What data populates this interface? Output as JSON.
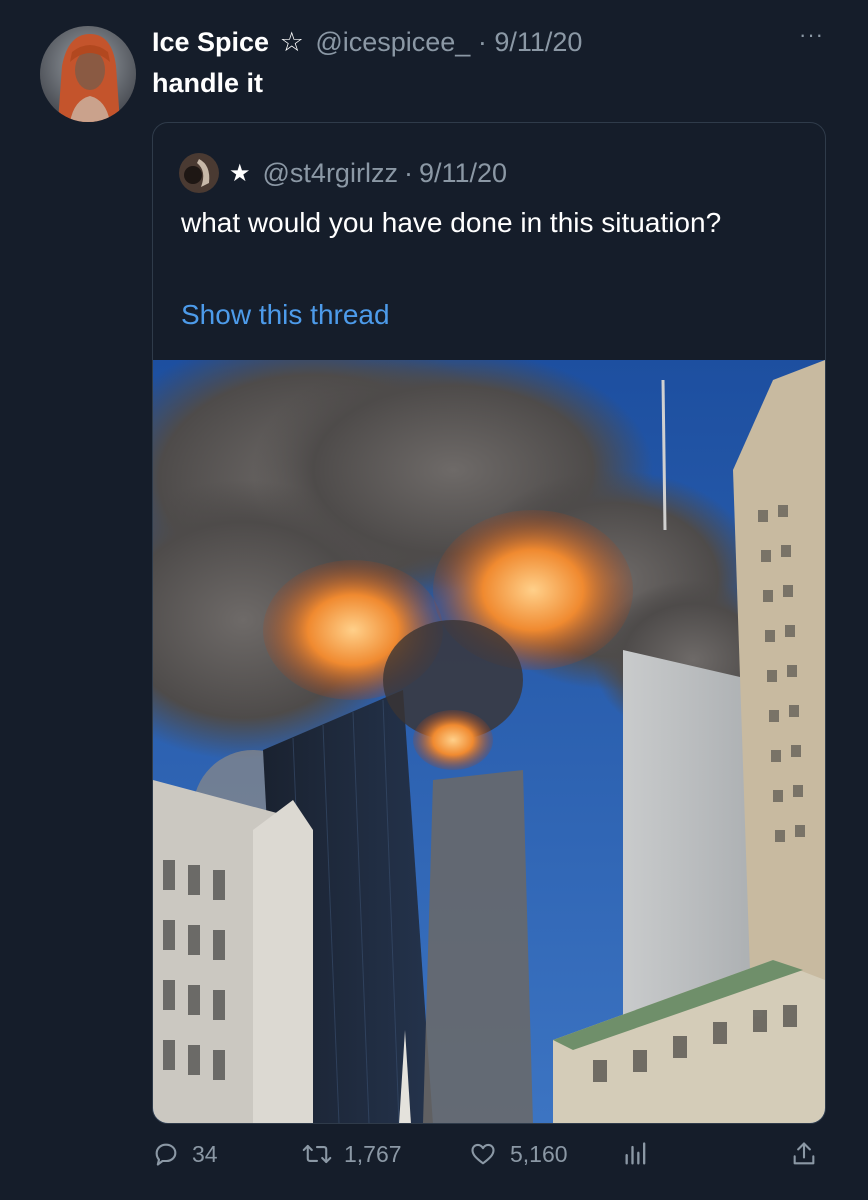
{
  "tweet": {
    "author_name": "Ice Spice",
    "star": "☆",
    "handle": "@icespicee_",
    "separator": "·",
    "date": "9/11/20",
    "text": "handle it",
    "more_label": "···"
  },
  "quoted": {
    "star": "★",
    "handle": "@st4rgirlzz",
    "separator": "·",
    "date": "9/11/20",
    "text": "what would you have done in this situation?",
    "link_text": "Show this thread"
  },
  "actions": {
    "reply_count": "34",
    "retweet_count": "1,767",
    "like_count": "5,160"
  },
  "icons": [
    "more-icon",
    "reply-icon",
    "retweet-icon",
    "like-icon",
    "analytics-icon",
    "share-icon"
  ],
  "colors": {
    "background": "#151d2a",
    "text": "#ffffff",
    "muted": "#8b98a5",
    "link": "#4d9bea"
  }
}
